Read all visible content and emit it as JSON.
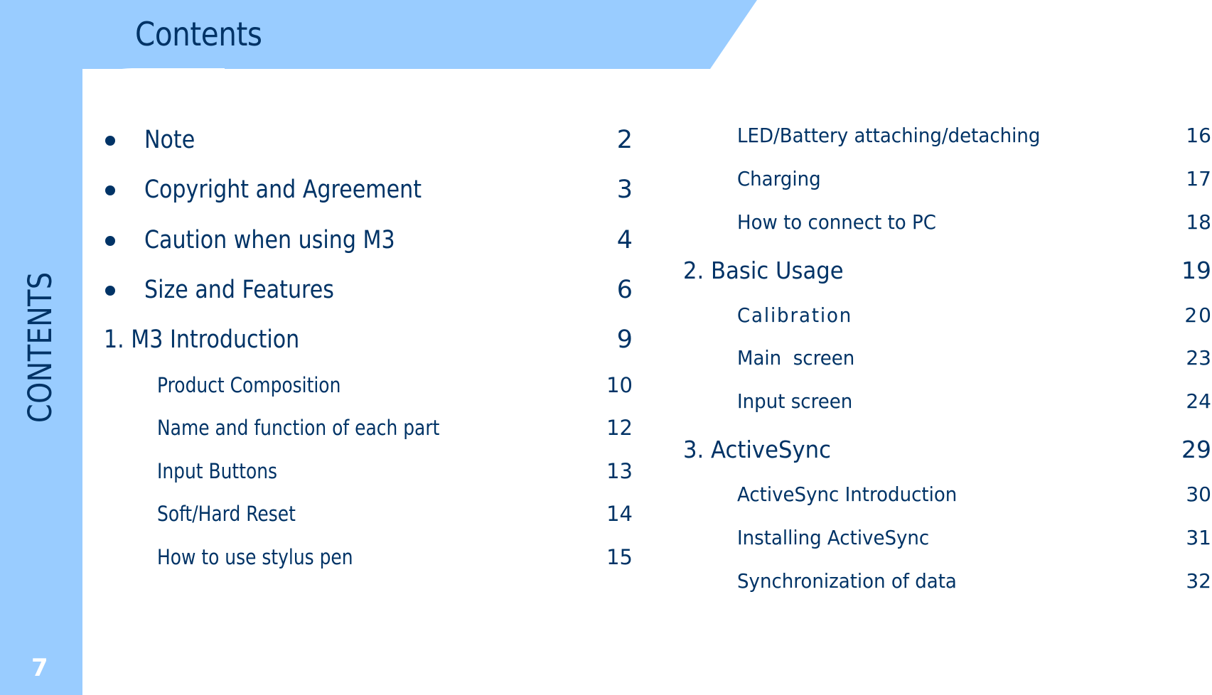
{
  "header": {
    "title": "Contents"
  },
  "side": {
    "label": "CONTENTS",
    "page_number": "7"
  },
  "colors": {
    "panel": "#99ccff",
    "text": "#003366",
    "page_number": "#ffffff"
  },
  "left_column": [
    {
      "type": "bullet",
      "label": "Note",
      "page": "2"
    },
    {
      "type": "bullet",
      "label": "Copyright and Agreement",
      "page": "3"
    },
    {
      "type": "bullet",
      "label": "Caution when using M3",
      "page": "4"
    },
    {
      "type": "bullet",
      "label": "Size and Features",
      "page": "6"
    },
    {
      "type": "heading",
      "label": "1. M3 Introduction",
      "page": "9"
    },
    {
      "type": "sub",
      "label": "Product Composition",
      "page": "10"
    },
    {
      "type": "sub",
      "label": "Name and function of each part",
      "page": "12"
    },
    {
      "type": "sub",
      "label": "Input Buttons",
      "page": "13"
    },
    {
      "type": "sub",
      "label": "Soft/Hard Reset",
      "page": "14"
    },
    {
      "type": "sub",
      "label": "How to use stylus pen",
      "page": "15"
    }
  ],
  "right_column": [
    {
      "type": "sub",
      "label": "LED/Battery attaching/detaching",
      "page": "16"
    },
    {
      "type": "sub",
      "label": "Charging",
      "page": "17"
    },
    {
      "type": "sub",
      "label": "How to connect to PC",
      "page": "18"
    },
    {
      "type": "heading",
      "label": "2. Basic Usage",
      "page": "19"
    },
    {
      "type": "sub",
      "label": "Calibration",
      "page": "20"
    },
    {
      "type": "sub",
      "label": "Main  screen",
      "page": "23"
    },
    {
      "type": "sub",
      "label": "Input screen",
      "page": "24"
    },
    {
      "type": "heading",
      "label": "3. ActiveSync",
      "page": "29"
    },
    {
      "type": "sub",
      "label": "ActiveSync Introduction",
      "page": "30"
    },
    {
      "type": "sub",
      "label": "Installing ActiveSync",
      "page": "31"
    },
    {
      "type": "sub",
      "label": "Synchronization of data",
      "page": "32"
    }
  ]
}
